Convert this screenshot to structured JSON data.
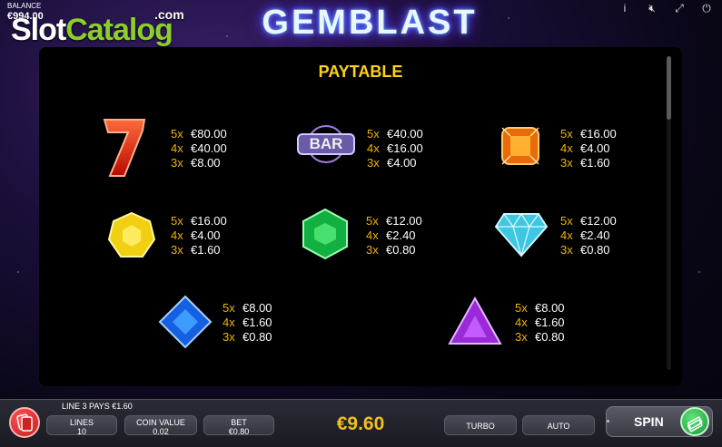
{
  "balance": {
    "label": "BALANCE",
    "value": "€994.00"
  },
  "watermark": {
    "part1": "Slot",
    "part2": "Catalog",
    "suffix": ".com"
  },
  "logo": {
    "text": "GEMBLAST"
  },
  "top_icons": [
    "info-icon",
    "sound-off-icon",
    "fullscreen-icon",
    "power-icon"
  ],
  "top_icon_glyphs": {
    "info": "i",
    "sound": "🔇︎",
    "fullscreen": "⤢",
    "power": "⏻"
  },
  "paytable": {
    "title": "PAYTABLE",
    "symbols": [
      {
        "id": "seven",
        "icon": "red-seven-icon",
        "pays": [
          [
            "5x",
            "€80.00"
          ],
          [
            "4x",
            "€40.00"
          ],
          [
            "3x",
            "€8.00"
          ]
        ]
      },
      {
        "id": "bar",
        "icon": "bar-icon",
        "label": "BAR",
        "pays": [
          [
            "5x",
            "€40.00"
          ],
          [
            "4x",
            "€16.00"
          ],
          [
            "3x",
            "€4.00"
          ]
        ]
      },
      {
        "id": "orange",
        "icon": "orange-gem-icon",
        "pays": [
          [
            "5x",
            "€16.00"
          ],
          [
            "4x",
            "€4.00"
          ],
          [
            "3x",
            "€1.60"
          ]
        ]
      },
      {
        "id": "yellow",
        "icon": "yellow-gem-icon",
        "pays": [
          [
            "5x",
            "€16.00"
          ],
          [
            "4x",
            "€4.00"
          ],
          [
            "3x",
            "€1.60"
          ]
        ]
      },
      {
        "id": "green",
        "icon": "green-gem-icon",
        "pays": [
          [
            "5x",
            "€12.00"
          ],
          [
            "4x",
            "€2.40"
          ],
          [
            "3x",
            "€0.80"
          ]
        ]
      },
      {
        "id": "diamond",
        "icon": "cyan-diamond-icon",
        "pays": [
          [
            "5x",
            "€12.00"
          ],
          [
            "4x",
            "€2.40"
          ],
          [
            "3x",
            "€0.80"
          ]
        ]
      },
      {
        "id": "blue",
        "icon": "blue-gem-icon",
        "pays": [
          [
            "5x",
            "€8.00"
          ],
          [
            "4x",
            "€1.60"
          ],
          [
            "3x",
            "€0.80"
          ]
        ]
      },
      {
        "id": "purple",
        "icon": "purple-gem-icon",
        "pays": [
          [
            "5x",
            "€8.00"
          ],
          [
            "4x",
            "€1.60"
          ],
          [
            "3x",
            "€0.80"
          ]
        ]
      }
    ]
  },
  "bottom": {
    "line_pays": "LINE 3 PAYS €1.60",
    "lines": {
      "label": "LINES",
      "value": "10"
    },
    "coin_value": {
      "label": "COIN VALUE",
      "value": "0.02"
    },
    "bet": {
      "label": "BET",
      "value": "€0.80"
    },
    "total": "€9.60",
    "turbo": "TURBO",
    "auto": "AUTO",
    "spin": "SPIN"
  },
  "colors": {
    "pay_multiplier": "#f0b400",
    "pay_value": "#ffffff",
    "title": "#ffd21a",
    "total": "#f0c020"
  }
}
